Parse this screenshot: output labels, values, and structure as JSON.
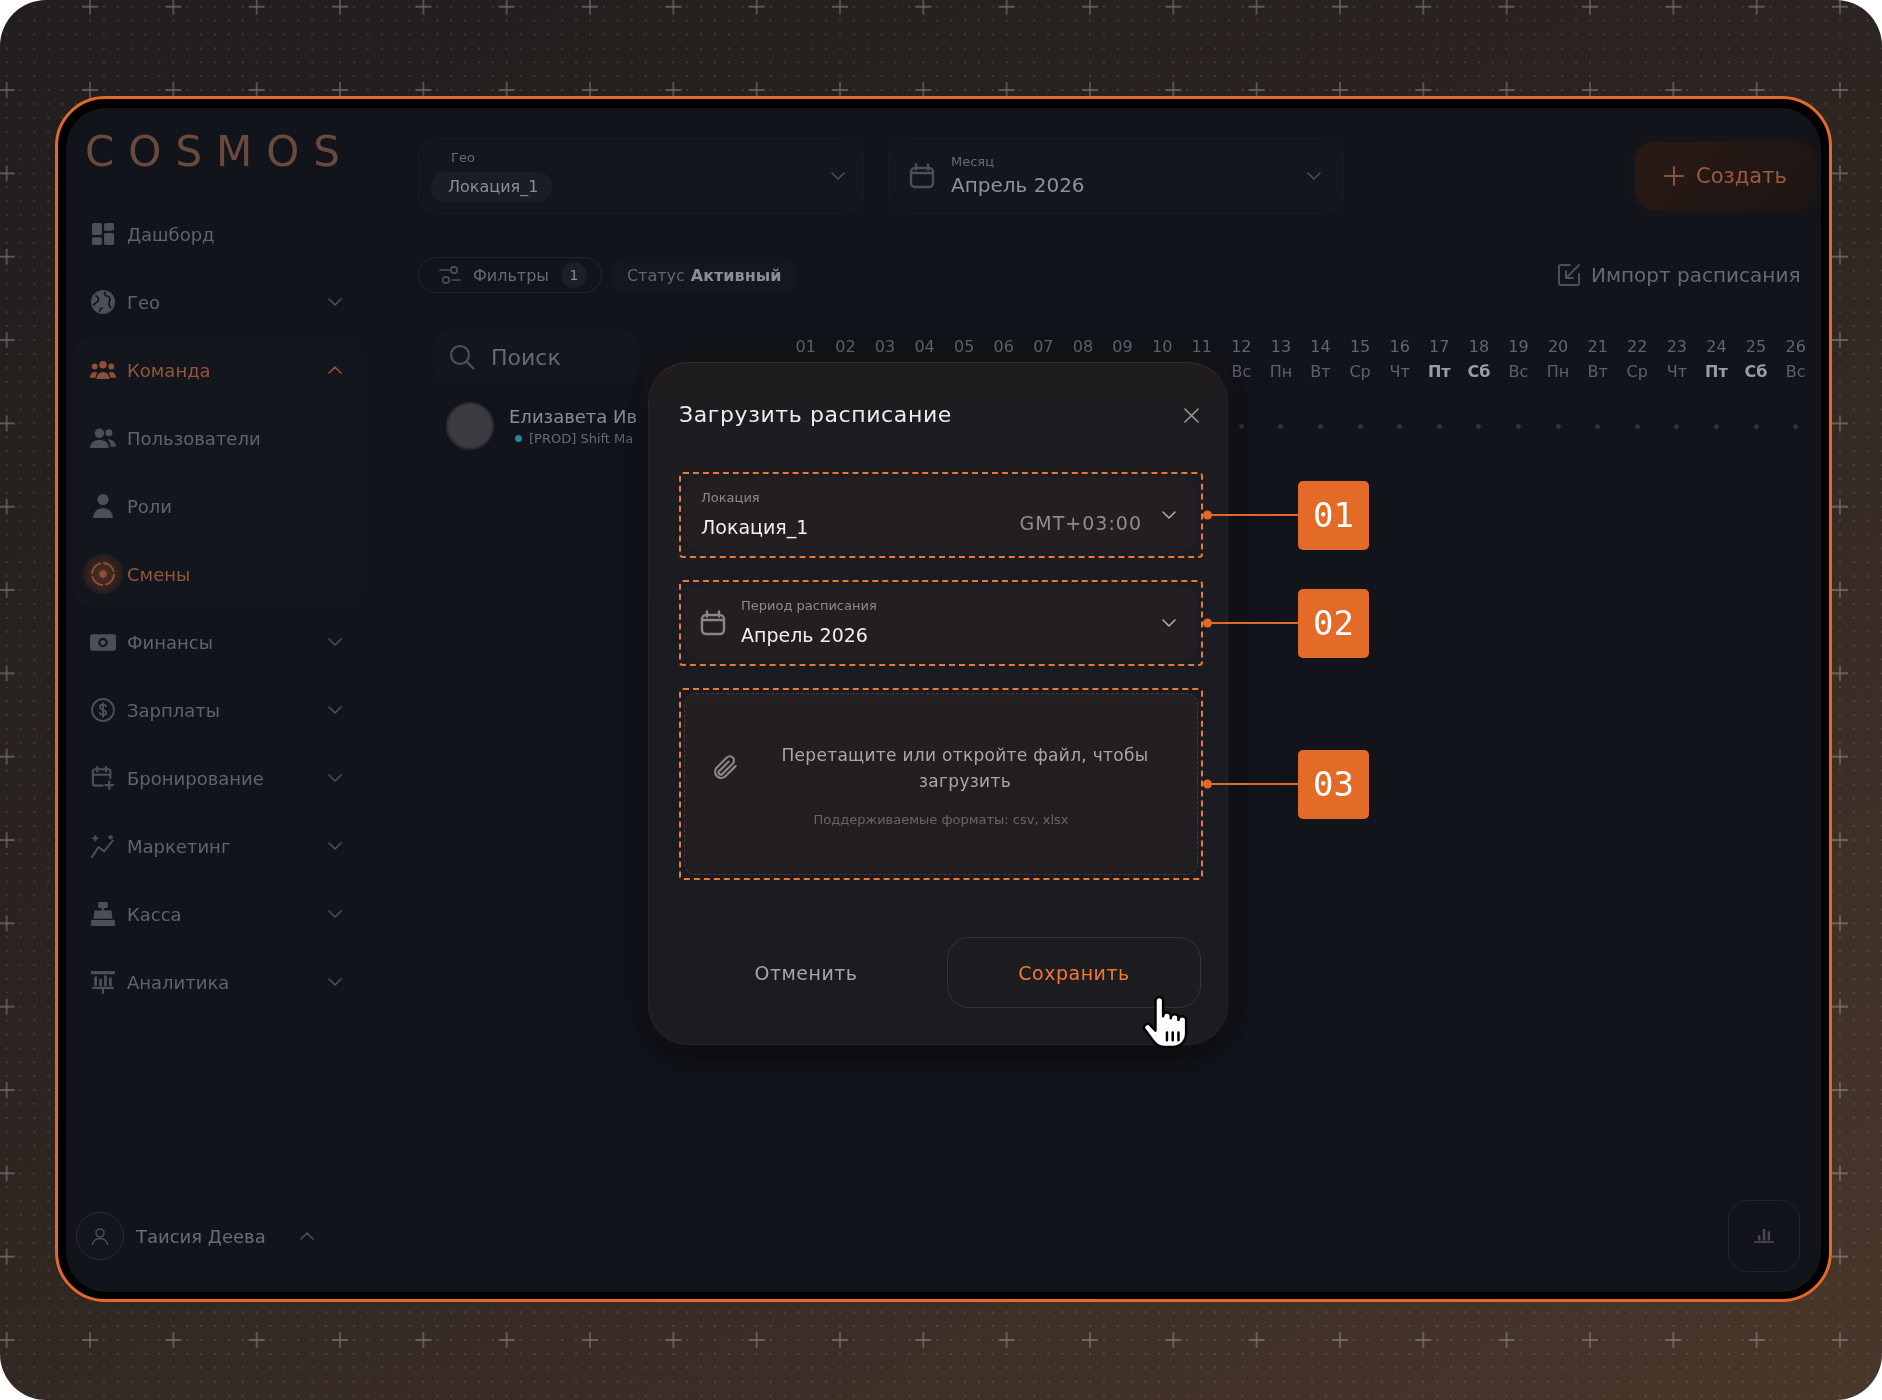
{
  "sidebar": {
    "logo": "COSMOS",
    "items": [
      {
        "kind": "link",
        "label": "Дашборд",
        "selected": false
      },
      {
        "kind": "group",
        "label": "Гео",
        "selected": false,
        "expanded": false
      },
      {
        "kind": "group",
        "label": "Команда",
        "selected": true,
        "expanded": true,
        "children": [
          {
            "label": "Пользователи",
            "selected": false
          },
          {
            "label": "Роли",
            "selected": false
          },
          {
            "label": "Смены",
            "selected": true
          }
        ]
      },
      {
        "kind": "group",
        "label": "Финансы",
        "selected": false,
        "expanded": false
      },
      {
        "kind": "group",
        "label": "Зарплаты",
        "selected": false,
        "expanded": false
      },
      {
        "kind": "group",
        "label": "Бронирование",
        "selected": false,
        "expanded": false
      },
      {
        "kind": "group",
        "label": "Маркетинг",
        "selected": false,
        "expanded": false
      },
      {
        "kind": "group",
        "label": "Касса",
        "selected": false,
        "expanded": false
      },
      {
        "kind": "group",
        "label": "Аналитика",
        "selected": false,
        "expanded": false
      }
    ],
    "user": {
      "name": "Таисия Деева"
    }
  },
  "toolbar": {
    "geo_select": {
      "label": "Гео",
      "value": "Локация_1"
    },
    "month_select": {
      "label": "Месяц",
      "value": "Апрель 2026"
    },
    "create_button": "Создать"
  },
  "filters": {
    "filter_button": {
      "label": "Фильтры",
      "count": "1"
    },
    "status_chip": {
      "label": "Статус",
      "value": "Активный"
    },
    "import_link": "Импорт расписания"
  },
  "search": {
    "placeholder": "Поиск"
  },
  "calendar": {
    "days": [
      {
        "number": "01"
      },
      {
        "number": "02"
      },
      {
        "number": "03"
      },
      {
        "number": "04"
      },
      {
        "number": "05"
      },
      {
        "number": "06"
      },
      {
        "number": "07"
      },
      {
        "number": "08"
      },
      {
        "number": "09"
      },
      {
        "number": "10"
      },
      {
        "number": "11"
      },
      {
        "number": "12",
        "weekday": "Вс",
        "highlighted": false
      },
      {
        "number": "13",
        "weekday": "Пн",
        "highlighted": false
      },
      {
        "number": "14",
        "weekday": "Вт",
        "highlighted": false
      },
      {
        "number": "15",
        "weekday": "Ср",
        "highlighted": false
      },
      {
        "number": "16",
        "weekday": "Чт",
        "highlighted": false
      },
      {
        "number": "17",
        "weekday": "Пт",
        "highlighted": true
      },
      {
        "number": "18",
        "weekday": "Сб",
        "highlighted": true
      },
      {
        "number": "19",
        "weekday": "Вс",
        "highlighted": false
      },
      {
        "number": "20",
        "weekday": "Пн",
        "highlighted": false
      },
      {
        "number": "21",
        "weekday": "Вт",
        "highlighted": false
      },
      {
        "number": "22",
        "weekday": "Ср",
        "highlighted": false
      },
      {
        "number": "23",
        "weekday": "Чт",
        "highlighted": false
      },
      {
        "number": "24",
        "weekday": "Пт",
        "highlighted": true
      },
      {
        "number": "25",
        "weekday": "Сб",
        "highlighted": true
      },
      {
        "number": "26",
        "weekday": "Вс",
        "highlighted": false
      }
    ]
  },
  "employees": [
    {
      "name": "Елизавета Ив",
      "role": "[PROD] Shift Ma"
    }
  ],
  "dialog": {
    "title": "Загрузить расписание",
    "fields": [
      {
        "kind": "select",
        "label": "Локация",
        "value": "Локация_1",
        "suffix": "GMT+03:00",
        "callout": "01"
      },
      {
        "kind": "period",
        "label": "Период расписания",
        "value": "Апрель 2026",
        "callout": "02"
      },
      {
        "kind": "dropzone",
        "text": "Перетащите или откройте файл, чтобы загрузить",
        "hint": "Поддерживаемые форматы: csv, xlsx",
        "callout": "03"
      }
    ],
    "cancel_button": "Отменить",
    "save_button": "Сохранить"
  }
}
